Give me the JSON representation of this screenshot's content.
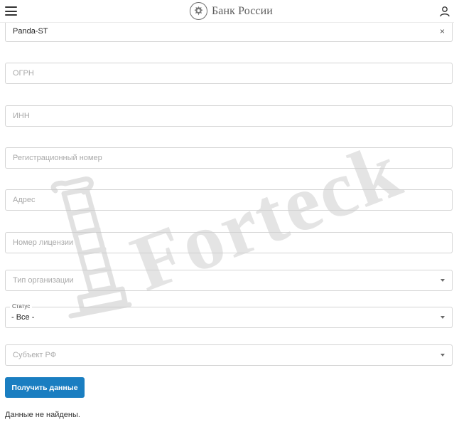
{
  "header": {
    "brand_name": "Банк России"
  },
  "form": {
    "name_value": "Panda-ST",
    "clear_symbol": "×",
    "ogrn_placeholder": "ОГРН",
    "inn_placeholder": "ИНН",
    "reg_number_placeholder": "Регистрационный номер",
    "address_placeholder": "Адрес",
    "license_placeholder": "Номер лицензии",
    "org_type_placeholder": "Тип организации",
    "status_label": "Статус",
    "status_value": "- Все -",
    "region_placeholder": "Субъект РФ",
    "submit_label": "Получить данные"
  },
  "result": {
    "message": "Данные не найдены."
  },
  "watermark": {
    "text": "Forteck"
  },
  "icons": {
    "menu": "hamburger-menu-icon",
    "emblem": "bank-emblem-icon",
    "user": "user-icon",
    "clear": "clear-icon",
    "caret": "chevron-down-icon",
    "watermark_logo": "scroll-pillar-logo-icon"
  },
  "colors": {
    "accent_button": "#1a7ec1",
    "brand_text": "#5c5c5c",
    "placeholder_text": "#a9a9a9",
    "field_border": "#d4d4d4"
  }
}
